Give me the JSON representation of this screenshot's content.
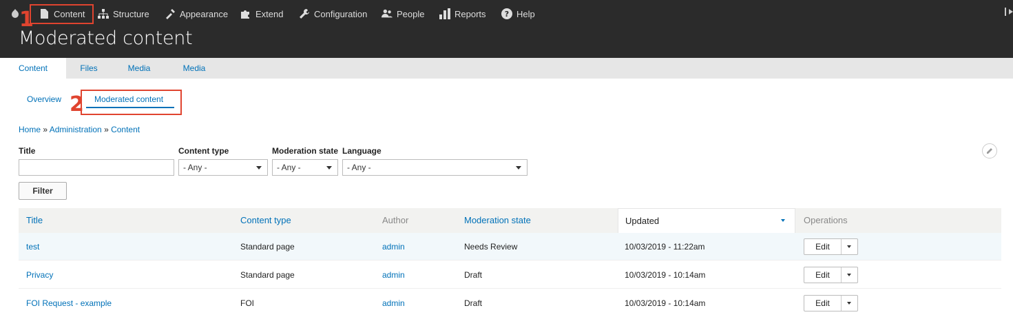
{
  "toolbar": {
    "items": [
      {
        "label": "Content",
        "icon": "file-icon"
      },
      {
        "label": "Structure",
        "icon": "sitemap-icon"
      },
      {
        "label": "Appearance",
        "icon": "brush-icon"
      },
      {
        "label": "Extend",
        "icon": "puzzle-icon"
      },
      {
        "label": "Configuration",
        "icon": "wrench-icon"
      },
      {
        "label": "People",
        "icon": "people-icon"
      },
      {
        "label": "Reports",
        "icon": "bar-chart-icon"
      },
      {
        "label": "Help",
        "icon": "help-icon"
      }
    ],
    "collapse_icon": "collapse-icon"
  },
  "page_title": "Moderated content",
  "annotations": [
    "1",
    "2"
  ],
  "primary_tabs": [
    "Content",
    "Files",
    "Media",
    "Media"
  ],
  "secondary_tabs": [
    "Overview",
    "Moderated content"
  ],
  "breadcrumb": {
    "home": "Home",
    "sep": " » ",
    "admin": "Administration",
    "content": "Content"
  },
  "filters": {
    "title_label": "Title",
    "title_value": "",
    "content_type_label": "Content type",
    "content_type_value": "- Any -",
    "moderation_state_label": "Moderation state",
    "moderation_state_value": "- Any -",
    "language_label": "Language",
    "language_value": "- Any -",
    "filter_button": "Filter"
  },
  "table": {
    "headers": {
      "title": "Title",
      "content_type": "Content type",
      "author": "Author",
      "moderation_state": "Moderation state",
      "updated": "Updated",
      "operations": "Operations"
    },
    "rows": [
      {
        "title": "test",
        "content_type": "Standard page",
        "author": "admin",
        "state": "Needs Review",
        "updated": "10/03/2019 - 11:22am",
        "op": "Edit"
      },
      {
        "title": "Privacy",
        "content_type": "Standard page",
        "author": "admin",
        "state": "Draft",
        "updated": "10/03/2019 - 10:14am",
        "op": "Edit"
      },
      {
        "title": "FOI Request - example",
        "content_type": "FOI",
        "author": "admin",
        "state": "Draft",
        "updated": "10/03/2019 - 10:14am",
        "op": "Edit"
      }
    ]
  },
  "colors": {
    "link": "#0071b8",
    "toolbar_bg": "#2b2b2b",
    "annotation": "#e0442f"
  }
}
